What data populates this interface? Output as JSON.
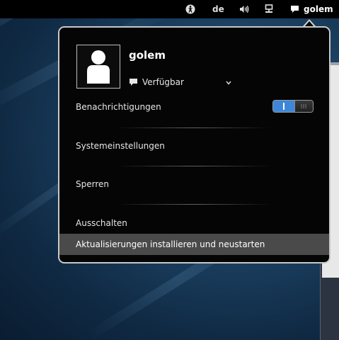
{
  "topbar": {
    "accessibility_icon": "accessibility-icon",
    "language": "de",
    "volume_icon": "volume-icon",
    "network_icon": "network-wired-icon",
    "user_icon": "chat-bubble-icon",
    "user_name": "golem"
  },
  "menu": {
    "user": {
      "name": "golem",
      "status": "Verfügbar",
      "status_icon": "chat-bubble-icon",
      "avatar_icon": "user-avatar-icon"
    },
    "notifications": {
      "label": "Benachrichtigungen",
      "enabled": true
    },
    "items": [
      {
        "label": "Systemeinstellungen"
      },
      {
        "label": "Sperren"
      },
      {
        "label": "Ausschalten"
      },
      {
        "label": "Aktualisierungen installieren und neustarten"
      }
    ]
  },
  "colors": {
    "accent": "#3e87d8",
    "menu_background": "#050505",
    "highlight": "#4a4a4a",
    "topbar": "#000000"
  }
}
